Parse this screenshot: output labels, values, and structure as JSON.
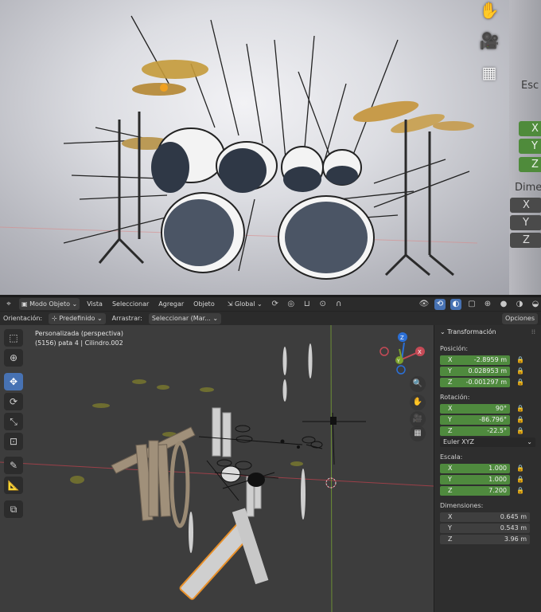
{
  "render": {
    "right_labels": [
      "Esc",
      "X",
      "Y",
      "Z",
      "Dime",
      "X",
      "Y",
      "Z"
    ],
    "tool_icons": [
      "hand-icon",
      "camera-icon",
      "grid-icon"
    ]
  },
  "header": {
    "mode_label": "Modo Objeto",
    "menus": [
      "Vista",
      "Seleccionar",
      "Agregar",
      "Objeto"
    ],
    "transform_orientation": "Global"
  },
  "tool_settings": {
    "orientation_label": "Orientación:",
    "orientation_value": "Predefinido",
    "drag_label": "Arrastrar:",
    "drag_value": "Seleccionar (Mar...",
    "options_label": "Opciones"
  },
  "viewport": {
    "view_name": "Personalizada (perspectiva)",
    "object_info": "(5156) pata 4 | Cilindro.002",
    "gizmo_axes": [
      "X",
      "Y",
      "Z"
    ]
  },
  "npanel": {
    "title": "Transformación",
    "location_label": "Posición:",
    "location": [
      {
        "axis": "X",
        "value": "-2.8959 m"
      },
      {
        "axis": "Y",
        "value": "0.028953 m"
      },
      {
        "axis": "Z",
        "value": "-0.001297 m"
      }
    ],
    "rotation_label": "Rotación:",
    "rotation": [
      {
        "axis": "X",
        "value": "90°"
      },
      {
        "axis": "Y",
        "value": "-86.796°"
      },
      {
        "axis": "Z",
        "value": "-22.5°"
      }
    ],
    "rotation_mode": "Euler XYZ",
    "scale_label": "Escala:",
    "scale": [
      {
        "axis": "X",
        "value": "1.000"
      },
      {
        "axis": "Y",
        "value": "1.000"
      },
      {
        "axis": "Z",
        "value": "7.200"
      }
    ],
    "dimensions_label": "Dimensiones:",
    "dimensions": [
      {
        "axis": "X",
        "value": "0.645 m"
      },
      {
        "axis": "Y",
        "value": "0.543 m"
      },
      {
        "axis": "Z",
        "value": "3.96 m"
      }
    ]
  },
  "colors": {
    "active_tool": "#4772b3",
    "field_green": "#4f8a3e",
    "selection_outline": "#e8902a",
    "x_axis": "#c54a56",
    "y_axis": "#7ba12c",
    "z_axis": "#2b6fd6"
  }
}
